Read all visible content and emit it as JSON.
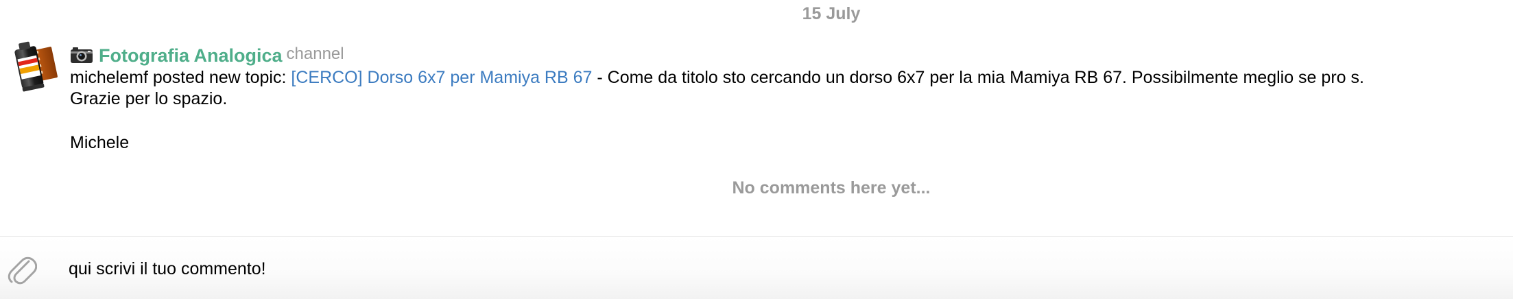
{
  "date_separator": "15 July",
  "post": {
    "channel_emoji": "camera-icon",
    "channel_name": "Fotografia Analogica",
    "channel_tag": "channel",
    "line1_prefix": "michelemf posted new topic: ",
    "line1_link": "[CERCO] Dorso 6x7 per Mamiya RB 67",
    "line1_suffix": " - Come da titolo sto cercando un dorso 6x7 per la mia Mamiya RB 67. Possibilmente meglio se pro s.",
    "line2": "Grazie per lo spazio.",
    "line3": "Michele"
  },
  "no_comments": "No comments here yet...",
  "composer": {
    "value": "qui scrivi il tuo commento!",
    "attach_icon": "paperclip-icon"
  },
  "colors": {
    "channel_name": "#4fae8a",
    "link": "#3b7bc0",
    "muted": "#9a9a9a"
  }
}
